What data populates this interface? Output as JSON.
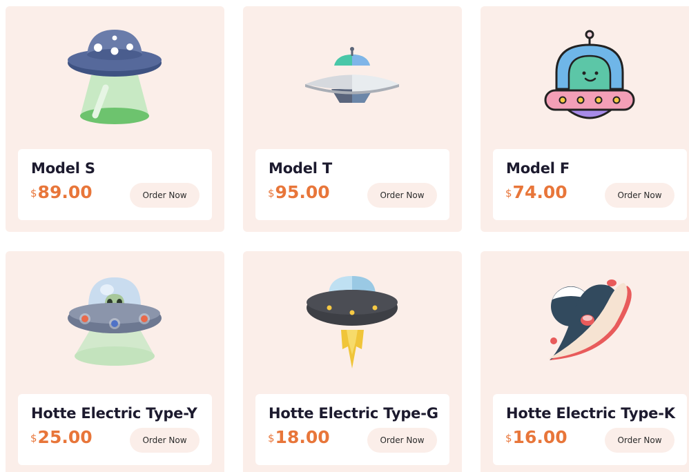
{
  "currency_symbol": "$",
  "products": [
    {
      "name": "Model S",
      "price": "89.00",
      "order_label": "Order Now",
      "icon": "ufo-tractor-beam-icon"
    },
    {
      "name": "Model T",
      "price": "95.00",
      "order_label": "Order Now",
      "icon": "flying-saucer-icon"
    },
    {
      "name": "Model F",
      "price": "74.00",
      "order_label": "Order Now",
      "icon": "alien-pilot-ufo-icon"
    },
    {
      "name": "Hotte Electric Type-Y",
      "price": "25.00",
      "order_label": "Order Now",
      "icon": "ufo-alien-dome-icon"
    },
    {
      "name": "Hotte Electric Type-G",
      "price": "18.00",
      "order_label": "Order Now",
      "icon": "ufo-rocket-flame-icon"
    },
    {
      "name": "Hotte Electric Type-K",
      "price": "16.00",
      "order_label": "Order Now",
      "icon": "ringed-planet-icon"
    }
  ],
  "colors": {
    "card_bg": "#fbeee9",
    "price": "#e8763a",
    "title": "#1c1a2e"
  }
}
